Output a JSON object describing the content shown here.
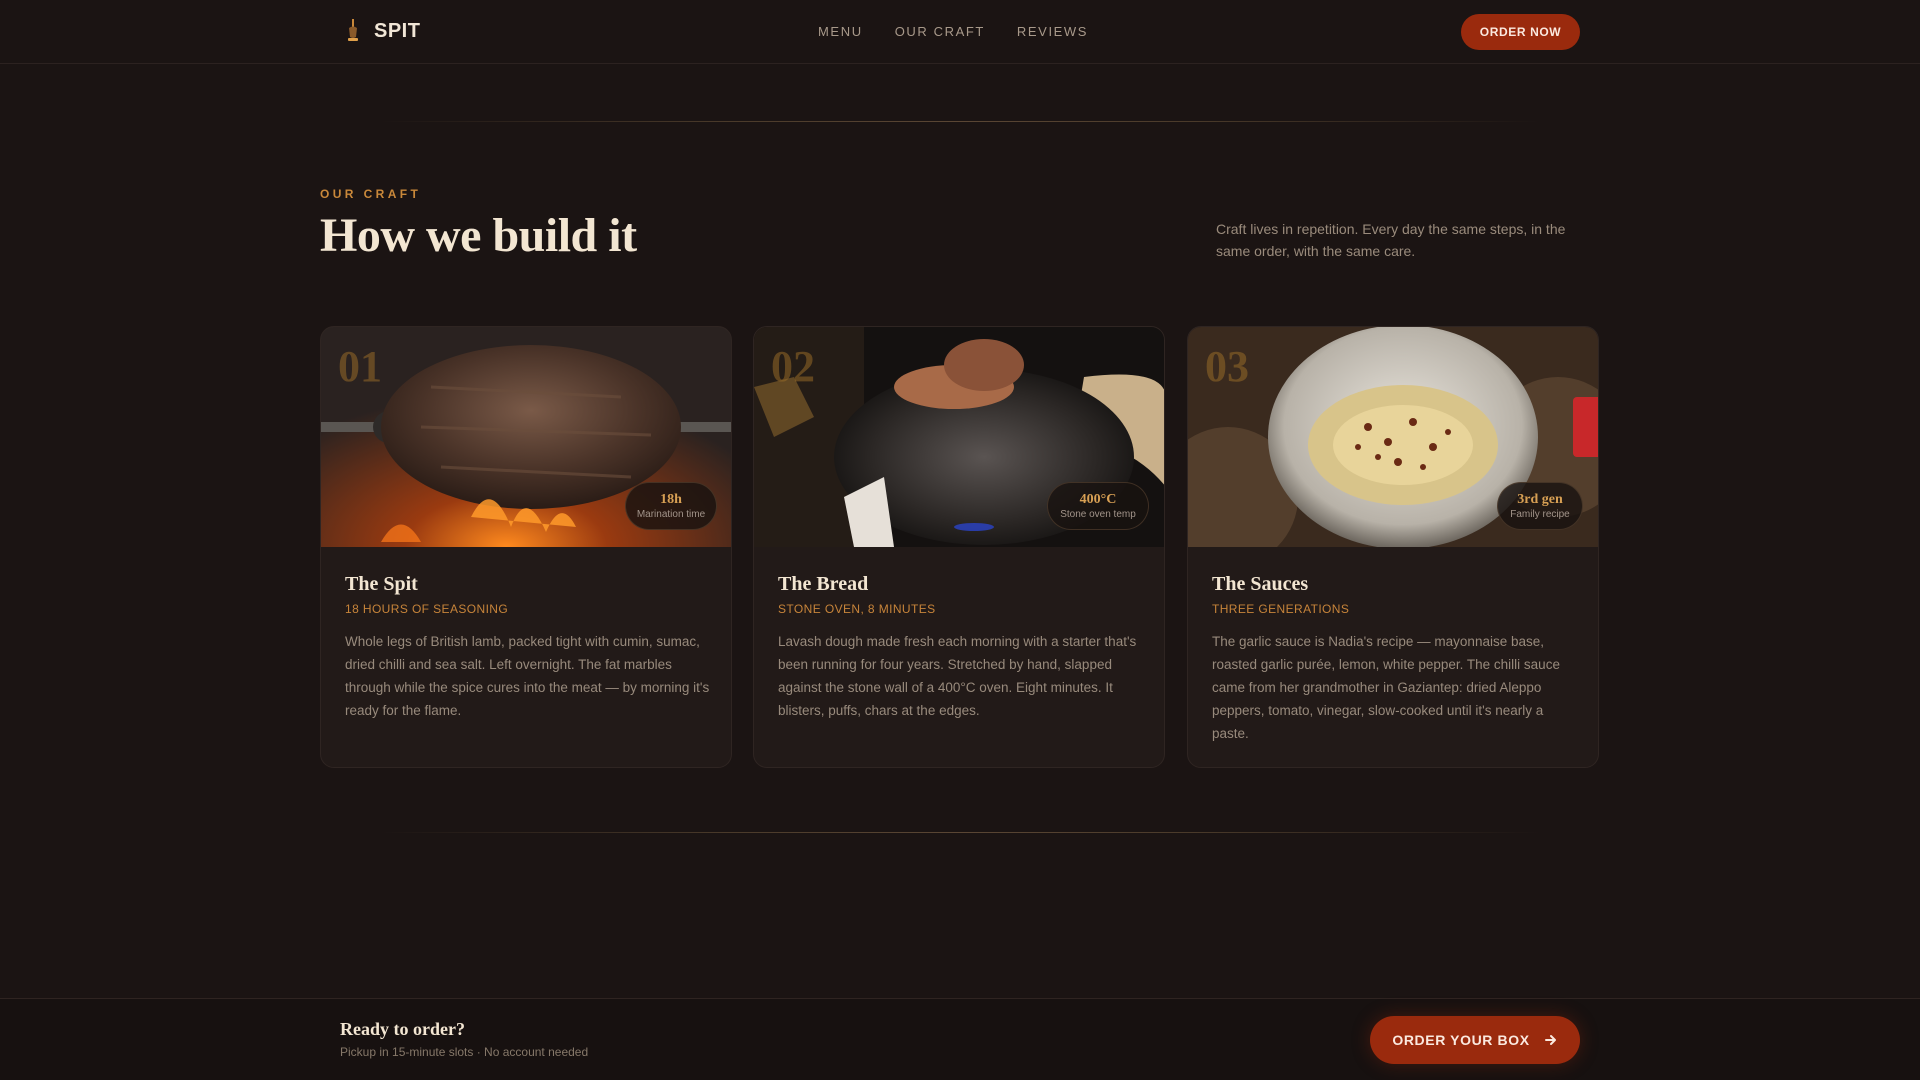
{
  "nav": {
    "brand": "SPIT",
    "links": [
      "MENU",
      "OUR CRAFT",
      "REVIEWS"
    ],
    "cta": "ORDER NOW",
    "brand_icon": "flame-skewer-icon"
  },
  "section": {
    "eyebrow": "OUR CRAFT",
    "title": "How we build it",
    "lead": "Craft lives in repetition. Every day the same steps, in the same order, with the same care."
  },
  "cards": [
    {
      "number": "01",
      "stat_value": "18h",
      "stat_label": "Marination time",
      "title": "The Spit",
      "subtitle": "18 HOURS OF SEASONING",
      "body": "Whole legs of British lamb, packed tight with cumin, sumac, dried chilli and sea salt. Left overnight. The fat marbles through while the spice cures into the meat — by morning it's ready for the flame."
    },
    {
      "number": "02",
      "stat_value": "400°C",
      "stat_label": "Stone oven temp",
      "title": "The Bread",
      "subtitle": "STONE OVEN, 8 MINUTES",
      "body": "Lavash dough made fresh each morning with a starter that's been running for four years. Stretched by hand, slapped against the stone wall of a 400°C oven. Eight minutes. It blisters, puffs, chars at the edges."
    },
    {
      "number": "03",
      "stat_value": "3rd gen",
      "stat_label": "Family recipe",
      "title": "The Sauces",
      "subtitle": "THREE GENERATIONS",
      "body": "The garlic sauce is Nadia's recipe — mayonnaise base, roasted garlic purée, lemon, white pepper. The chilli sauce came from her grandmother in Gaziantep: dried Aleppo peppers, tomato, vinegar, slow-cooked until it's nearly a paste."
    }
  ],
  "bottom": {
    "title": "Ready to order?",
    "subtitle": "Pickup in 15-minute slots · No account needed",
    "cta": "ORDER YOUR BOX",
    "cta_icon": "arrow-right-icon"
  }
}
